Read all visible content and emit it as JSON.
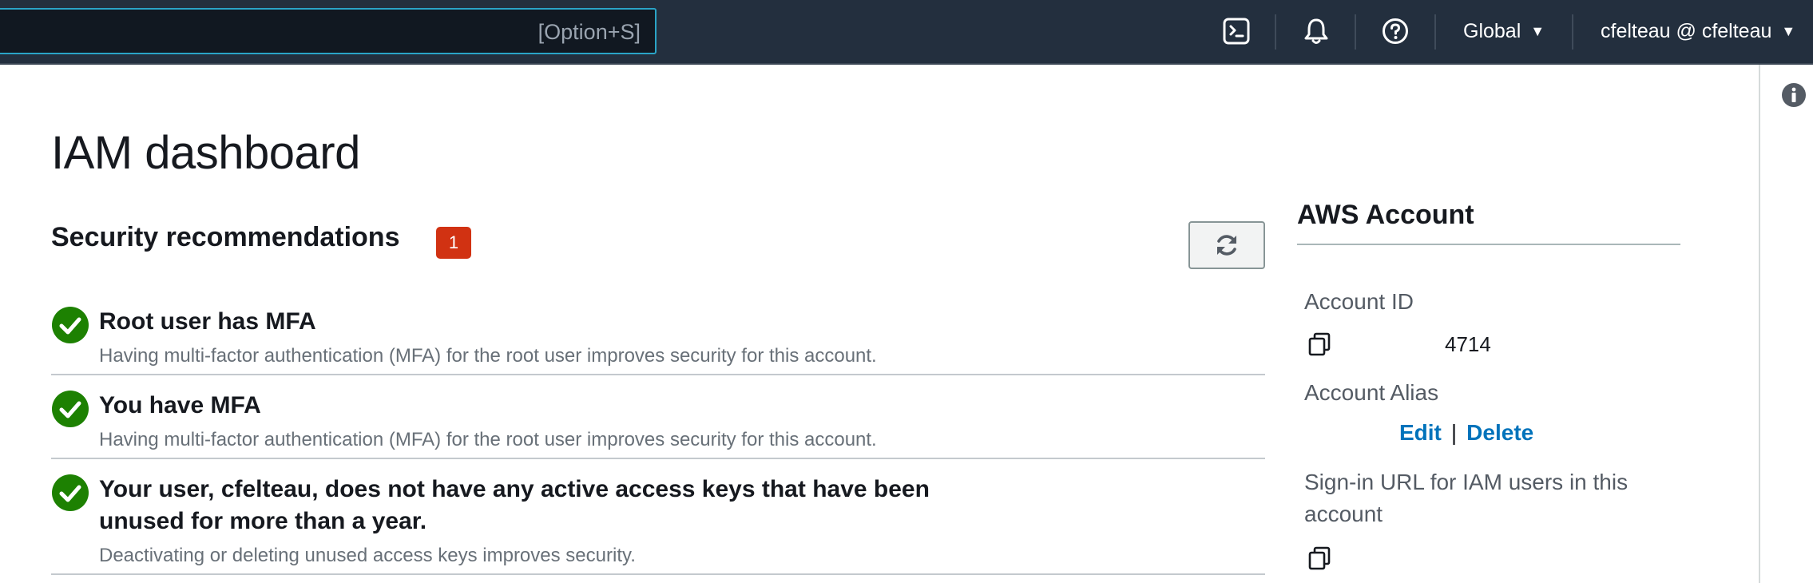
{
  "topnav": {
    "search_shortcut": "[Option+S]",
    "region": "Global",
    "account_user": "cfelteau @ cfelteau",
    "icons": [
      "cloudshell-icon",
      "bell-icon",
      "help-icon"
    ]
  },
  "page": {
    "title": "IAM dashboard"
  },
  "security": {
    "heading": "Security recommendations",
    "badge_count": "1",
    "items": [
      {
        "title": "Root user has MFA",
        "description": "Having multi-factor authentication (MFA) for the root user improves security for this account.",
        "status": "complete"
      },
      {
        "title": "You have MFA",
        "description": "Having multi-factor authentication (MFA) for the root user improves security for this account.",
        "status": "complete"
      },
      {
        "title": "Your user, cfelteau, does not have any active access keys that have been unused for more than a year.",
        "description": "Deactivating or deleting unused access keys improves security.",
        "status": "complete"
      }
    ]
  },
  "account": {
    "heading": "AWS Account",
    "account_id_label": "Account ID",
    "account_id_value": "4714",
    "alias_label": "Account Alias",
    "edit_label": "Edit",
    "delete_label": "Delete",
    "signin_label": "Sign-in URL for IAM users in this account"
  },
  "colors": {
    "nav_bg": "#232f3e",
    "search_border": "#2aa4c7",
    "badge_red": "#d13212",
    "success_green": "#1d8102",
    "link_blue": "#0073bb"
  }
}
